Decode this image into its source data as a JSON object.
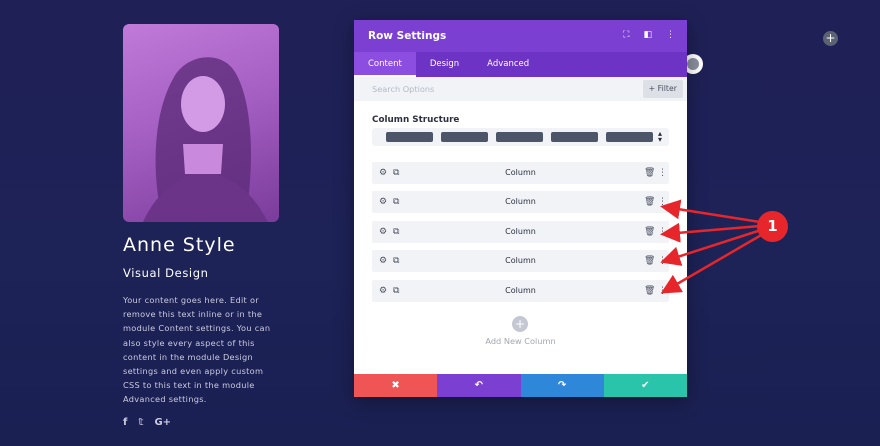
{
  "profile": {
    "name": "Anne Style",
    "role": "Visual Design",
    "bio": "Your content goes here. Edit or remove this text inline or in the module Content settings. You can also style every aspect of this content in the module Design settings and even apply custom CSS to this text in the module Advanced settings.",
    "social_icons": [
      "facebook-icon",
      "twitter-icon",
      "google-plus-icon"
    ],
    "social_glyphs": [
      "f",
      "𝕥",
      "G+"
    ]
  },
  "modal": {
    "title": "Row Settings",
    "tabs": [
      {
        "label": "Content",
        "active": true
      },
      {
        "label": "Design",
        "active": false
      },
      {
        "label": "Advanced",
        "active": false
      }
    ],
    "search_placeholder": "Search Options",
    "filter_label": "+ Filter",
    "column_structure_label": "Column Structure",
    "columns": [
      {
        "label": "Column"
      },
      {
        "label": "Column"
      },
      {
        "label": "Column"
      },
      {
        "label": "Column"
      },
      {
        "label": "Column"
      }
    ],
    "add_column_label": "Add New Column",
    "footer": {
      "cancel": "✖",
      "undo": "↶",
      "redo": "↷",
      "save": "✔"
    }
  },
  "annotation": {
    "badge": "1"
  },
  "colors": {
    "page_bg": "#1f2056",
    "modal_header": "#7b3fd2",
    "tab_bar": "#6c33c4",
    "footer_cancel": "#ef5555",
    "footer_undo": "#7b3fd2",
    "footer_redo": "#2e87d8",
    "footer_save": "#29c4a9",
    "annotation": "#e6262b"
  }
}
